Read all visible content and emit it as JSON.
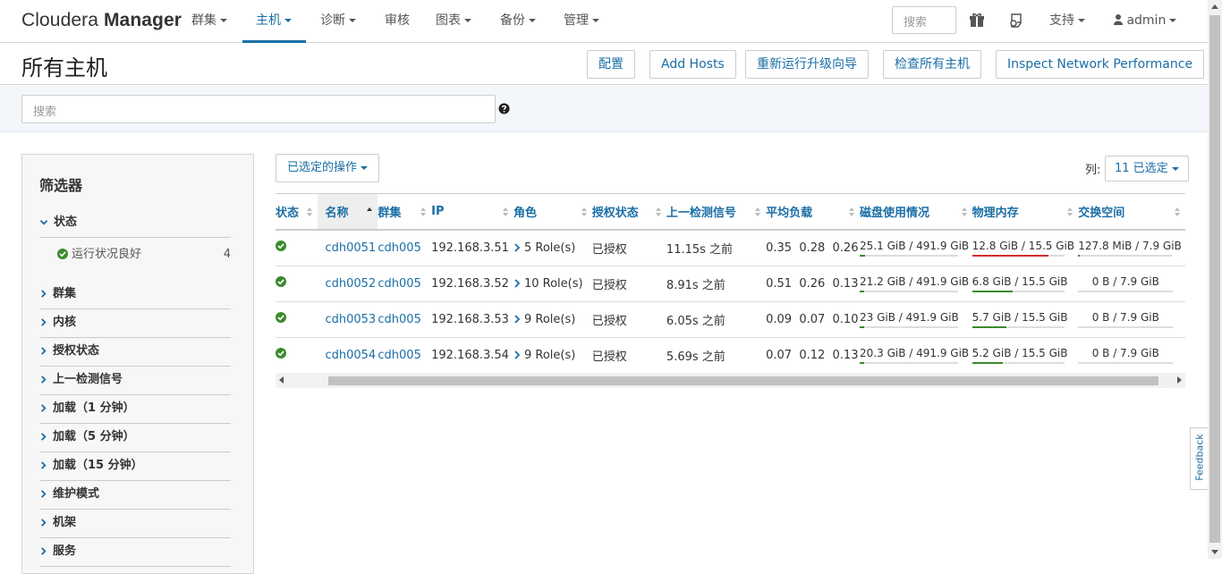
{
  "nav": {
    "brand_light": "Cloudera",
    "brand_bold": "Manager",
    "items": [
      {
        "label": "群集",
        "dropdown": true
      },
      {
        "label": "主机",
        "dropdown": true,
        "active": true
      },
      {
        "label": "诊断",
        "dropdown": true
      },
      {
        "label": "审核",
        "dropdown": false
      },
      {
        "label": "图表",
        "dropdown": true
      },
      {
        "label": "备份",
        "dropdown": true
      },
      {
        "label": "管理",
        "dropdown": true
      }
    ],
    "search_placeholder": "搜索",
    "support_label": "支持",
    "user_label": "admin"
  },
  "page": {
    "title": "所有主机",
    "buttons": [
      "配置",
      "Add Hosts",
      "重新运行升级向导",
      "检查所有主机",
      "Inspect Network Performance"
    ],
    "search_placeholder": "搜索"
  },
  "filters": {
    "title": "筛选器",
    "status_section": "状态",
    "status_good_label": "运行状况良好",
    "status_good_count": "4",
    "sections": [
      "群集",
      "内核",
      "授权状态",
      "上一检测信号",
      "加载（1 分钟）",
      "加载（5 分钟）",
      "加载（15 分钟）",
      "维护模式",
      "机架",
      "服务"
    ]
  },
  "table": {
    "actions_label": "已选定的操作",
    "columns_label": "列:",
    "columns_selected": "11 已选定",
    "headers": [
      "状态",
      "名称",
      "群集",
      "IP",
      "角色",
      "授权状态",
      "上一检测信号",
      "平均负载",
      "磁盘使用情况",
      "物理内存",
      "交换空间"
    ],
    "rows": [
      {
        "name": "cdh0051",
        "cluster": "cdh005",
        "ip": "192.168.3.51",
        "roles": "5 Role(s)",
        "auth": "已授权",
        "heartbeat": "11.15s 之前",
        "load": [
          "0.35",
          "0.28",
          "0.26"
        ],
        "disk": "25.1 GiB / 491.9 GiB",
        "disk_pct": 5.1,
        "mem": "12.8 GiB / 15.5 GiB",
        "mem_pct": 82.6,
        "mem_warn": true,
        "swap": "127.8 MiB / 7.9 GiB",
        "swap_pct": 1.6
      },
      {
        "name": "cdh0052",
        "cluster": "cdh005",
        "ip": "192.168.3.52",
        "roles": "10 Role(s)",
        "auth": "已授权",
        "heartbeat": "8.91s 之前",
        "load": [
          "0.51",
          "0.26",
          "0.13"
        ],
        "disk": "21.2 GiB / 491.9 GiB",
        "disk_pct": 4.3,
        "mem": "6.8 GiB / 15.5 GiB",
        "mem_pct": 43.9,
        "mem_warn": false,
        "swap": "0 B / 7.9 GiB",
        "swap_pct": 0
      },
      {
        "name": "cdh0053",
        "cluster": "cdh005",
        "ip": "192.168.3.53",
        "roles": "9 Role(s)",
        "auth": "已授权",
        "heartbeat": "6.05s 之前",
        "load": [
          "0.09",
          "0.07",
          "0.10"
        ],
        "disk": "23 GiB / 491.9 GiB",
        "disk_pct": 4.7,
        "mem": "5.7 GiB / 15.5 GiB",
        "mem_pct": 36.8,
        "mem_warn": false,
        "swap": "0 B / 7.9 GiB",
        "swap_pct": 0
      },
      {
        "name": "cdh0054",
        "cluster": "cdh005",
        "ip": "192.168.3.54",
        "roles": "9 Role(s)",
        "auth": "已授权",
        "heartbeat": "5.69s 之前",
        "load": [
          "0.07",
          "0.12",
          "0.13"
        ],
        "disk": "20.3 GiB / 491.9 GiB",
        "disk_pct": 4.1,
        "mem": "5.2 GiB / 15.5 GiB",
        "mem_pct": 33.5,
        "mem_warn": false,
        "swap": "0 B / 7.9 GiB",
        "swap_pct": 0
      }
    ]
  },
  "feedback_label": "Feedback",
  "colors": {
    "link": "#1a6ea6",
    "ok": "#3c8b2d",
    "warn": "#d62b2b"
  }
}
